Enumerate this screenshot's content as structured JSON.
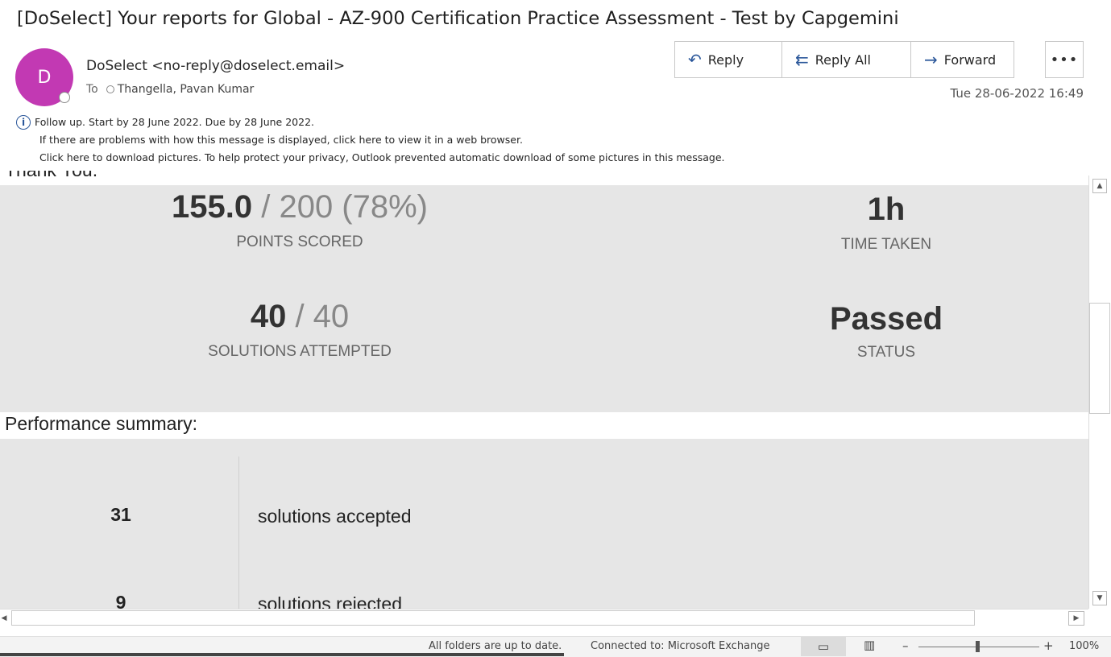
{
  "email": {
    "subject": "[DoSelect] Your reports for Global - AZ-900 Certification Practice Assessment - Test by Capgemini",
    "avatar_initial": "D",
    "sender": "DoSelect <no-reply@doselect.email>",
    "to_label": "To",
    "recipient": "Thangella, Pavan Kumar",
    "date": "Tue 28-06-2022 16:49",
    "avatar_color": "#c239b3"
  },
  "actions": {
    "reply": "Reply",
    "reply_all": "Reply All",
    "forward": "Forward",
    "more": "•••"
  },
  "info": {
    "follow_up": "Follow up.  Start by 28 June 2022.  Due by 28 June 2022.",
    "problems": "If there are problems with how this message is displayed, click here to view it in a web browser.",
    "pictures": "Click here to download pictures. To help protect your privacy, Outlook prevented automatic download of some pictures in this message."
  },
  "body": {
    "cut_text": "Thank You.",
    "score_value": "155.0",
    "score_rest": " / 200 (78%)",
    "score_caption": "POINTS SCORED",
    "time_value": "1h",
    "time_caption": "TIME TAKEN",
    "solutions_value": "40",
    "solutions_rest": " / 40",
    "solutions_caption": "SOLUTIONS ATTEMPTED",
    "status_value": "Passed",
    "status_caption": "STATUS",
    "perf_heading": "Performance summary:",
    "accepted_count": "31",
    "accepted_label": "solutions accepted",
    "rejected_count": "9",
    "rejected_label": "solutions rejected"
  },
  "statusbar": {
    "sync": "All folders are up to date.",
    "connection": "Connected to: Microsoft Exchange",
    "zoom_minus": "–",
    "zoom_plus": "+",
    "zoom": "100%"
  }
}
